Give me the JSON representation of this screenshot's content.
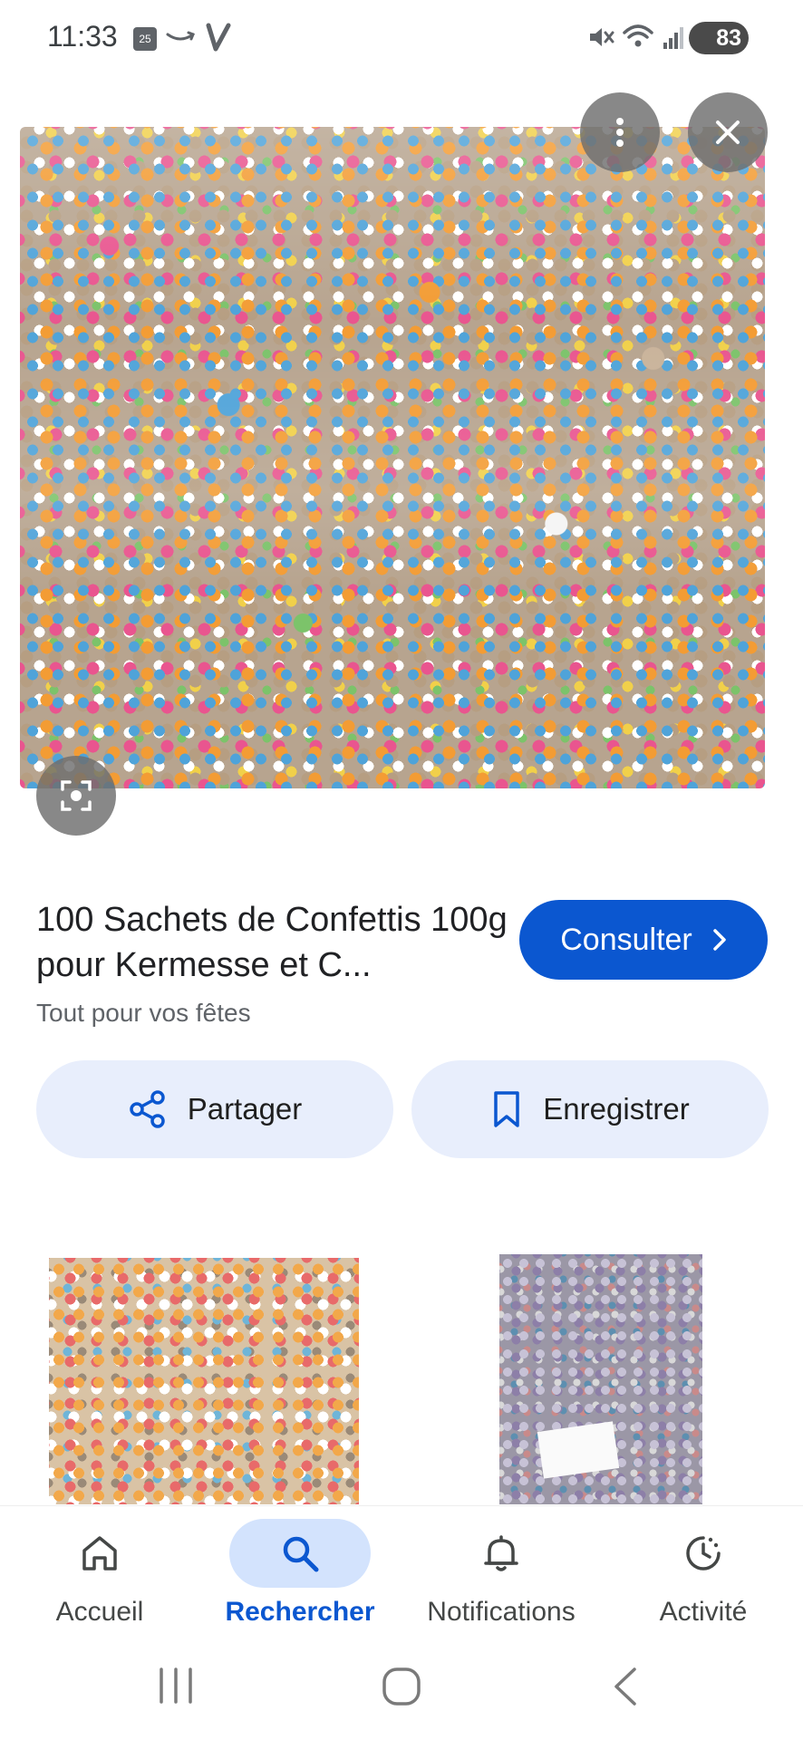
{
  "status_bar": {
    "time": "11:33",
    "calendar_badge": "25",
    "battery": "83"
  },
  "result": {
    "title": "100 Sachets de Confettis 100g pour Kermesse et C...",
    "source": "Tout pour vos fêtes",
    "visit_label": "Consulter"
  },
  "actions": {
    "share_label": "Partager",
    "save_label": "Enregistrer"
  },
  "bottom_nav": {
    "items": [
      {
        "label": "Accueil",
        "icon": "home-icon"
      },
      {
        "label": "Rechercher",
        "icon": "search-icon",
        "selected": true
      },
      {
        "label": "Notifications",
        "icon": "bell-icon"
      },
      {
        "label": "Activité",
        "icon": "activity-icon"
      }
    ]
  },
  "colors": {
    "accent": "#0b57d0",
    "accent_container": "#d3e3fd",
    "tonal_button": "#e8eefc"
  }
}
